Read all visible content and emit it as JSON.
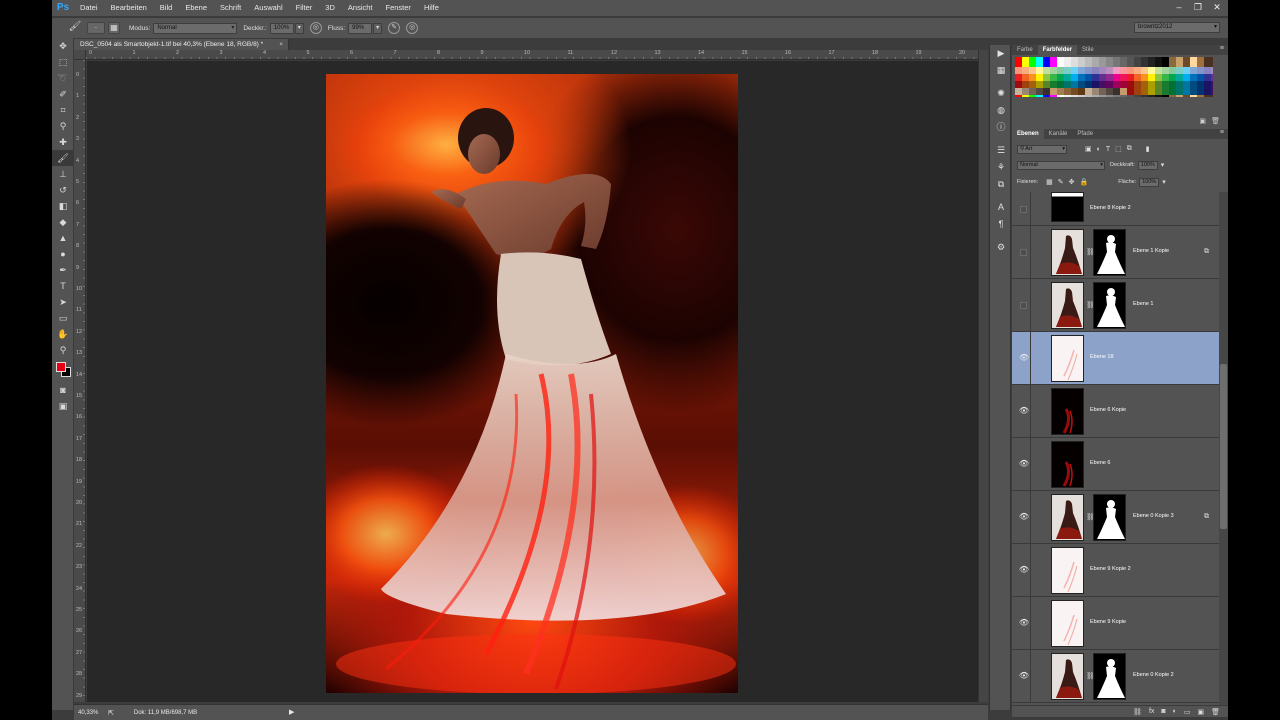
{
  "app": {
    "logo": "Ps",
    "menu": [
      "Datei",
      "Bearbeiten",
      "Bild",
      "Ebene",
      "Schrift",
      "Auswahl",
      "Filter",
      "3D",
      "Ansicht",
      "Fenster",
      "Hilfe"
    ],
    "window_controls": [
      "–",
      "❐",
      "✕"
    ]
  },
  "options": {
    "mode_label": "Modus:",
    "mode_value": "Normal",
    "opacity_label": "Deckkr.:",
    "opacity_value": "100%",
    "flow_label": "Fluss:",
    "flow_value": "99%",
    "workspace": "browntz2012"
  },
  "document": {
    "tab_title": "DSC_0504 als Smartobjekt-1.tif bei 40,3% (Ebene 18, RGB/8) *",
    "close": "×",
    "ruler_h": [
      "0",
      "1",
      "2",
      "3",
      "4",
      "5",
      "6",
      "7",
      "8",
      "9",
      "10",
      "11",
      "12",
      "13",
      "14",
      "15",
      "16",
      "17",
      "18",
      "19",
      "20",
      "21",
      "22"
    ],
    "ruler_v": [
      "0",
      "1",
      "2",
      "3",
      "4",
      "5",
      "6",
      "7",
      "8",
      "9",
      "10",
      "11",
      "12",
      "13",
      "14",
      "15",
      "16",
      "17",
      "18",
      "19",
      "20",
      "21",
      "22",
      "23",
      "24",
      "25",
      "26",
      "27",
      "28",
      "29"
    ]
  },
  "status": {
    "zoom": "40,33%",
    "doc_info": "Dok: 11,9 MB/698,7 MB"
  },
  "panels": {
    "color_tabs": [
      "Farbe",
      "Farbfelder",
      "Stile"
    ],
    "color_active": 1,
    "layer_tabs": [
      "Ebenen",
      "Kanäle",
      "Pfade"
    ],
    "layer_active": 0,
    "filter_kind": "Art",
    "blend_mode": "Normal",
    "opacity_label": "Deckkraft:",
    "opacity_value": "100%",
    "lock_label": "Fixieren:",
    "fill_label": "Fläche:",
    "fill_value": "100%"
  },
  "layers": [
    {
      "name": "Ebene 8 Kopie 2",
      "visible": false,
      "partial": true,
      "thumb": "th-black-strip",
      "mask": false,
      "smart": false,
      "selected": false
    },
    {
      "name": "Ebene 1 Kopie",
      "visible": false,
      "partial": false,
      "thumb": "th-fig-dark",
      "mask": true,
      "smart": true,
      "selected": false
    },
    {
      "name": "Ebene 1",
      "visible": false,
      "partial": false,
      "thumb": "th-fig-dark",
      "mask": true,
      "smart": false,
      "selected": false
    },
    {
      "name": "Ebene 18",
      "visible": true,
      "partial": false,
      "thumb": "th-fig-light",
      "mask": false,
      "smart": false,
      "selected": true
    },
    {
      "name": "Ebene 6 Kopie",
      "visible": true,
      "partial": false,
      "thumb": "th-red-dark",
      "mask": false,
      "smart": false,
      "selected": false
    },
    {
      "name": "Ebene 6",
      "visible": true,
      "partial": false,
      "thumb": "th-red-dark",
      "mask": false,
      "smart": false,
      "selected": false
    },
    {
      "name": "Ebene 0 Kopie 3",
      "visible": true,
      "partial": false,
      "thumb": "th-fig-dark",
      "mask": true,
      "smart": true,
      "selected": false
    },
    {
      "name": "Ebene 9 Kopie 2",
      "visible": true,
      "partial": false,
      "thumb": "th-fig-light",
      "mask": false,
      "smart": false,
      "selected": false
    },
    {
      "name": "Ebene 9 Kopie",
      "visible": true,
      "partial": false,
      "thumb": "th-fig-light",
      "mask": false,
      "smart": false,
      "selected": false
    },
    {
      "name": "Ebene 0 Kopie 2",
      "visible": true,
      "partial": false,
      "thumb": "th-fig-dark",
      "mask": true,
      "smart": false,
      "selected": false
    }
  ],
  "icons": {
    "eye": "👁",
    "link": "⛓",
    "smart": "⧉"
  },
  "colors": {
    "foreground": "#e60012",
    "background": "#000000",
    "selection": "#8ca2c9"
  }
}
